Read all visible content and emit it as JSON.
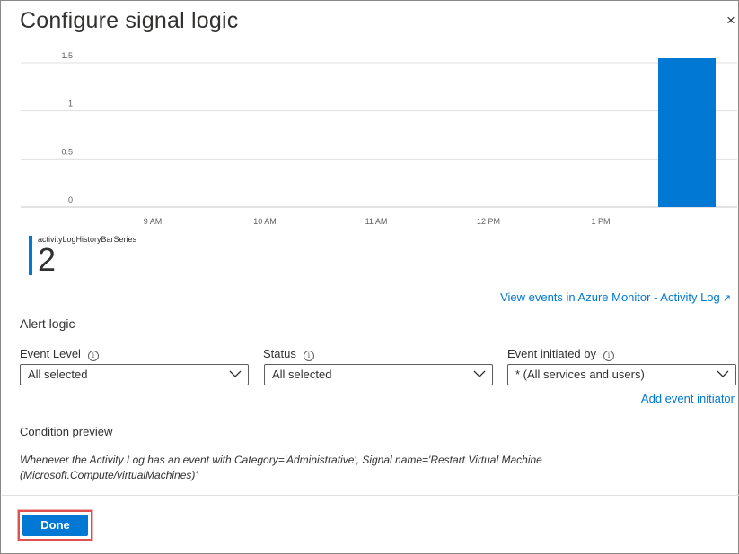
{
  "title": "Configure signal logic",
  "close_glyph": "×",
  "chart_data": {
    "type": "bar",
    "categories": [
      "9 AM",
      "10 AM",
      "11 AM",
      "12 PM",
      "1 PM",
      "latest"
    ],
    "series": [
      {
        "name": "activityLogHistoryBarSeries",
        "values": [
          0,
          0,
          0,
          0,
          0,
          2
        ],
        "color": "#0078d4"
      }
    ],
    "y_ticks": [
      "0",
      "0.5",
      "1",
      "1.5"
    ],
    "x_ticks": [
      "9 AM",
      "10 AM",
      "11 AM",
      "12 PM",
      "1 PM"
    ],
    "ylim": [
      0,
      2
    ],
    "grid": true
  },
  "legend": {
    "series_name": "activityLogHistoryBarSeries",
    "value": "2"
  },
  "view_events_link": "View events in Azure Monitor - Activity Log",
  "external_icon": "external-link-icon",
  "alert_logic": {
    "label": "Alert logic",
    "fields": [
      {
        "label": "Event Level",
        "value": "All selected"
      },
      {
        "label": "Status",
        "value": "All selected"
      },
      {
        "label": "Event initiated by",
        "value": "* (All services and users)"
      }
    ],
    "add_initiator": "Add event initiator"
  },
  "condition": {
    "label": "Condition preview",
    "text": "Whenever the Activity Log has an event with Category='Administrative', Signal name='Restart Virtual Machine (Microsoft.Compute/virtualMachines)'"
  },
  "done_label": "Done",
  "colors": {
    "accent": "#0078d4",
    "highlight": "#e05050"
  }
}
